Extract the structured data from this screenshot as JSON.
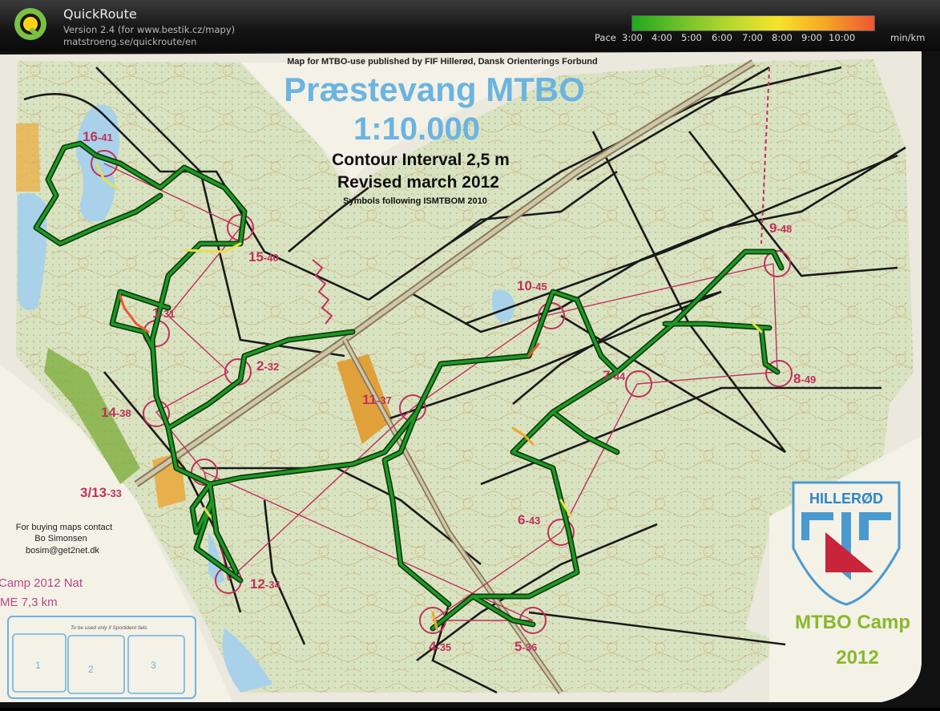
{
  "app": {
    "name": "QuickRoute",
    "version_line": "Version 2.4  (for www.bestik.cz/mapy)",
    "url_line": "matstroeng.se/quickroute/en"
  },
  "legend": {
    "pace_label": "Pace",
    "ticks": [
      "3:00",
      "4:00",
      "5:00",
      "6:00",
      "7:00",
      "8:00",
      "9:00",
      "10:00"
    ],
    "unit": "min/km",
    "colors": [
      "#1fa81f",
      "#6fc12a",
      "#b6d72e",
      "#f6e32c",
      "#f5a623",
      "#ee5533"
    ]
  },
  "map": {
    "header_note": "Map for MTBO-use published by FIF Hillerød, Dansk Orienterings Forbund",
    "title": "Præstevang MTBO",
    "scale": "1:10.000",
    "contour": "Contour Interval 2,5 m",
    "revised": "Revised march 2012",
    "symbols": "Symbols following ISMTBOM 2010",
    "contact_line1": "For buying maps contact",
    "contact_line2": "Bo Simonsen",
    "contact_line3": "bosim@get2net.dk",
    "course_line1": "Camp 2012 Nat",
    "course_line2": "ME 7,3 km",
    "box_caption": "To be used only  if Sportident fails",
    "boxes": [
      "1",
      "2",
      "3"
    ],
    "club": "HILLERØD",
    "camp_line1": "MTBO Camp",
    "camp_line2": "2012",
    "controls": [
      {
        "main": "16",
        "code": "41"
      },
      {
        "main": "15",
        "code": "40"
      },
      {
        "main": "1",
        "code": "31"
      },
      {
        "main": "2",
        "code": "32"
      },
      {
        "main": "14",
        "code": "38"
      },
      {
        "main": "3/13",
        "code": "33"
      },
      {
        "main": "12",
        "code": "34"
      },
      {
        "main": "11",
        "code": "37"
      },
      {
        "main": "10",
        "code": "45"
      },
      {
        "main": "9",
        "code": "48"
      },
      {
        "main": "8",
        "code": "49"
      },
      {
        "main": "7",
        "code": "44"
      },
      {
        "main": "6",
        "code": "43"
      },
      {
        "main": "4",
        "code": "35"
      },
      {
        "main": "5",
        "code": "36"
      }
    ],
    "colors": {
      "paper": "#f4f1e6",
      "forest": "#dbe6c4",
      "contour": "#c98d4e",
      "purple": "#c0305c",
      "title_blue": "#6cb4e0",
      "route": "#1e9a24"
    }
  }
}
